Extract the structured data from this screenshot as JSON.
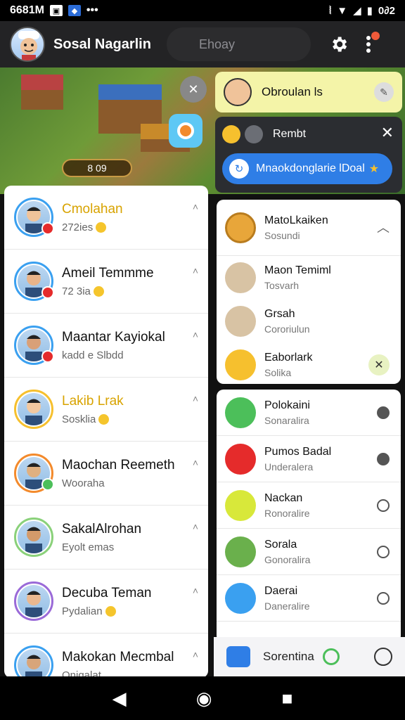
{
  "status": {
    "time": "6681M",
    "right_time": "0∂2"
  },
  "header": {
    "title": "Sosal Nagarlin",
    "search_placeholder": "Ehoay"
  },
  "game": {
    "badge": "8 09"
  },
  "notification_top": {
    "label": "Obroulan ls"
  },
  "notification_dark": {
    "title": "Rembt",
    "button": "Mnaokdonglarie lDoal"
  },
  "left_chats": [
    {
      "name": "Cmolahan",
      "sub": "272ies"
    },
    {
      "name": "Ameil Temmme",
      "sub": "72 3ia"
    },
    {
      "name": "Maantar Kayiokal",
      "sub": "kadd e Slbdd"
    },
    {
      "name": "Lakib Lrak",
      "sub": "Sosklia"
    },
    {
      "name": "Maochan Reemeth",
      "sub": "Wooraha"
    },
    {
      "name": "SakalAlrohan",
      "sub": "Eyolt emas"
    },
    {
      "name": "Decuba Teman",
      "sub": "Pydalian"
    },
    {
      "name": "Makokan Mecmbal",
      "sub": "Onigalat"
    }
  ],
  "right_group": {
    "title": "MatoLkaiken",
    "sub": "Sosundi",
    "members": [
      {
        "name": "Maon Temiml",
        "sub": "Tosvarh"
      },
      {
        "name": "Grsah",
        "sub": "Cororiulun"
      },
      {
        "name": "Eaborlark",
        "sub": "Solika"
      }
    ]
  },
  "right_list": [
    {
      "name": "Polokaini",
      "sub": "Sonaralira"
    },
    {
      "name": "Pumos Badal",
      "sub": "Underalera"
    },
    {
      "name": "Nackan",
      "sub": "Ronoralire"
    },
    {
      "name": "Sorala",
      "sub": "Gonoralira"
    },
    {
      "name": "Daerai",
      "sub": "Daneralire"
    }
  ],
  "bottom_strip": {
    "label": "Sorentina"
  },
  "colors": {
    "accent": "#2f7ee6",
    "yellow_card": "#f4f4a8",
    "dark_card": "#2b2d31"
  }
}
